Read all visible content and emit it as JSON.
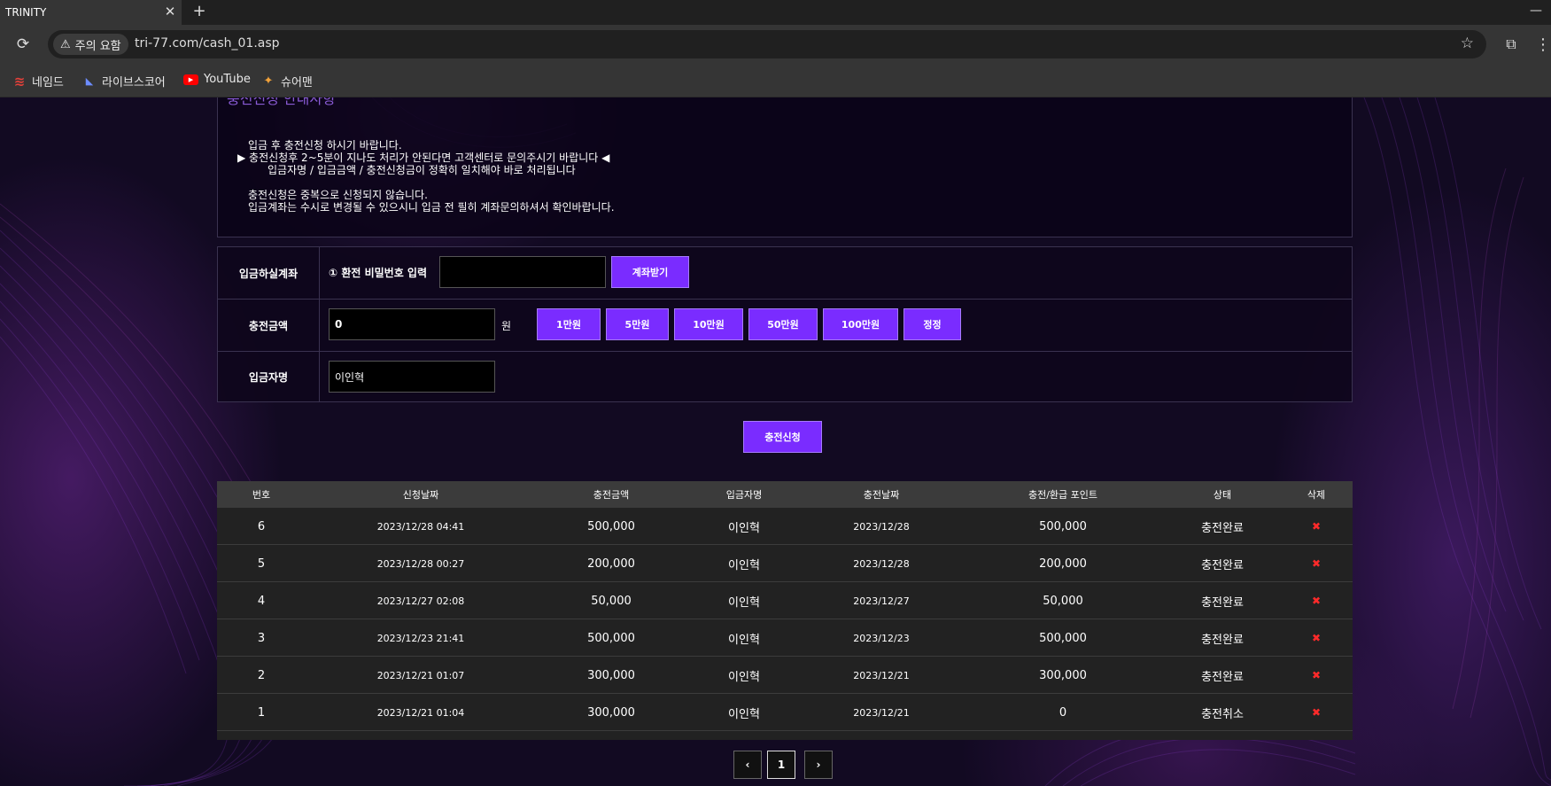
{
  "browser": {
    "tab_title": "TRINITY",
    "tab_close": "✕",
    "new_tab": "+",
    "minimize": "—",
    "warning_label": "주의 요함",
    "url": "tri-77.com/cash_01.asp",
    "bookmarks": [
      {
        "label": "네임드",
        "icon": "naver-icon"
      },
      {
        "label": "라이브스코어",
        "icon": "livescore-icon"
      },
      {
        "label": "YouTube",
        "icon": "youtube-icon"
      },
      {
        "label": "슈어맨",
        "icon": "sureman-icon"
      }
    ]
  },
  "notice": {
    "cut_heading": "충전신청 안내사항",
    "lines": [
      "입금 후 충전신청 하시기 바랍니다.",
      "▶ 충전신청후 2~5분이 지나도 처리가 안된다면 고객센터로 문의주시기 바랍니다 ◀",
      "입금자명 / 입금금액 / 충전신청금이 정확히 일치해야 바로 처리됩니다",
      "",
      "충전신청은 중복으로 신청되지 않습니다.",
      "입금계좌는 수시로 변경될 수 있으시니 입금 전 필히 계좌문의하셔서 확인바랍니다."
    ]
  },
  "form": {
    "account_label": "입금하실계좌",
    "password_step_label": "① 환전 비밀번호 입력",
    "password_value": "",
    "get_account_button": "계좌받기",
    "amount_label": "충전금액",
    "amount_value": "0",
    "won_unit": "원",
    "amount_buttons": [
      "1만원",
      "5만원",
      "10만원",
      "50만원",
      "100만원",
      "정정"
    ],
    "depositor_label": "입금자명",
    "depositor_value": "이인혁",
    "submit_button": "충전신청"
  },
  "history": {
    "columns": [
      "번호",
      "신청날짜",
      "충전금액",
      "입금자명",
      "충전날짜",
      "충전/환급 포인트",
      "상태",
      "삭제"
    ],
    "rows": [
      {
        "no": "6",
        "requested": "2023/12/28 04:41",
        "amount": "500,000",
        "name": "이인혁",
        "charged": "2023/12/28",
        "points": "500,000",
        "status": "충전완료",
        "del": "✖"
      },
      {
        "no": "5",
        "requested": "2023/12/28 00:27",
        "amount": "200,000",
        "name": "이인혁",
        "charged": "2023/12/28",
        "points": "200,000",
        "status": "충전완료",
        "del": "✖"
      },
      {
        "no": "4",
        "requested": "2023/12/27 02:08",
        "amount": "50,000",
        "name": "이인혁",
        "charged": "2023/12/27",
        "points": "50,000",
        "status": "충전완료",
        "del": "✖"
      },
      {
        "no": "3",
        "requested": "2023/12/23 21:41",
        "amount": "500,000",
        "name": "이인혁",
        "charged": "2023/12/23",
        "points": "500,000",
        "status": "충전완료",
        "del": "✖"
      },
      {
        "no": "2",
        "requested": "2023/12/21 01:07",
        "amount": "300,000",
        "name": "이인혁",
        "charged": "2023/12/21",
        "points": "300,000",
        "status": "충전완료",
        "del": "✖"
      },
      {
        "no": "1",
        "requested": "2023/12/21 01:04",
        "amount": "300,000",
        "name": "이인혁",
        "charged": "2023/12/21",
        "points": "0",
        "status": "충전취소",
        "del": "✖"
      }
    ]
  },
  "pagination": {
    "prev": "‹",
    "current": "1",
    "next": "›"
  },
  "colors": {
    "accent": "#7a2cff",
    "delete": "#ff2a2a",
    "page_bg": "#120a22"
  }
}
